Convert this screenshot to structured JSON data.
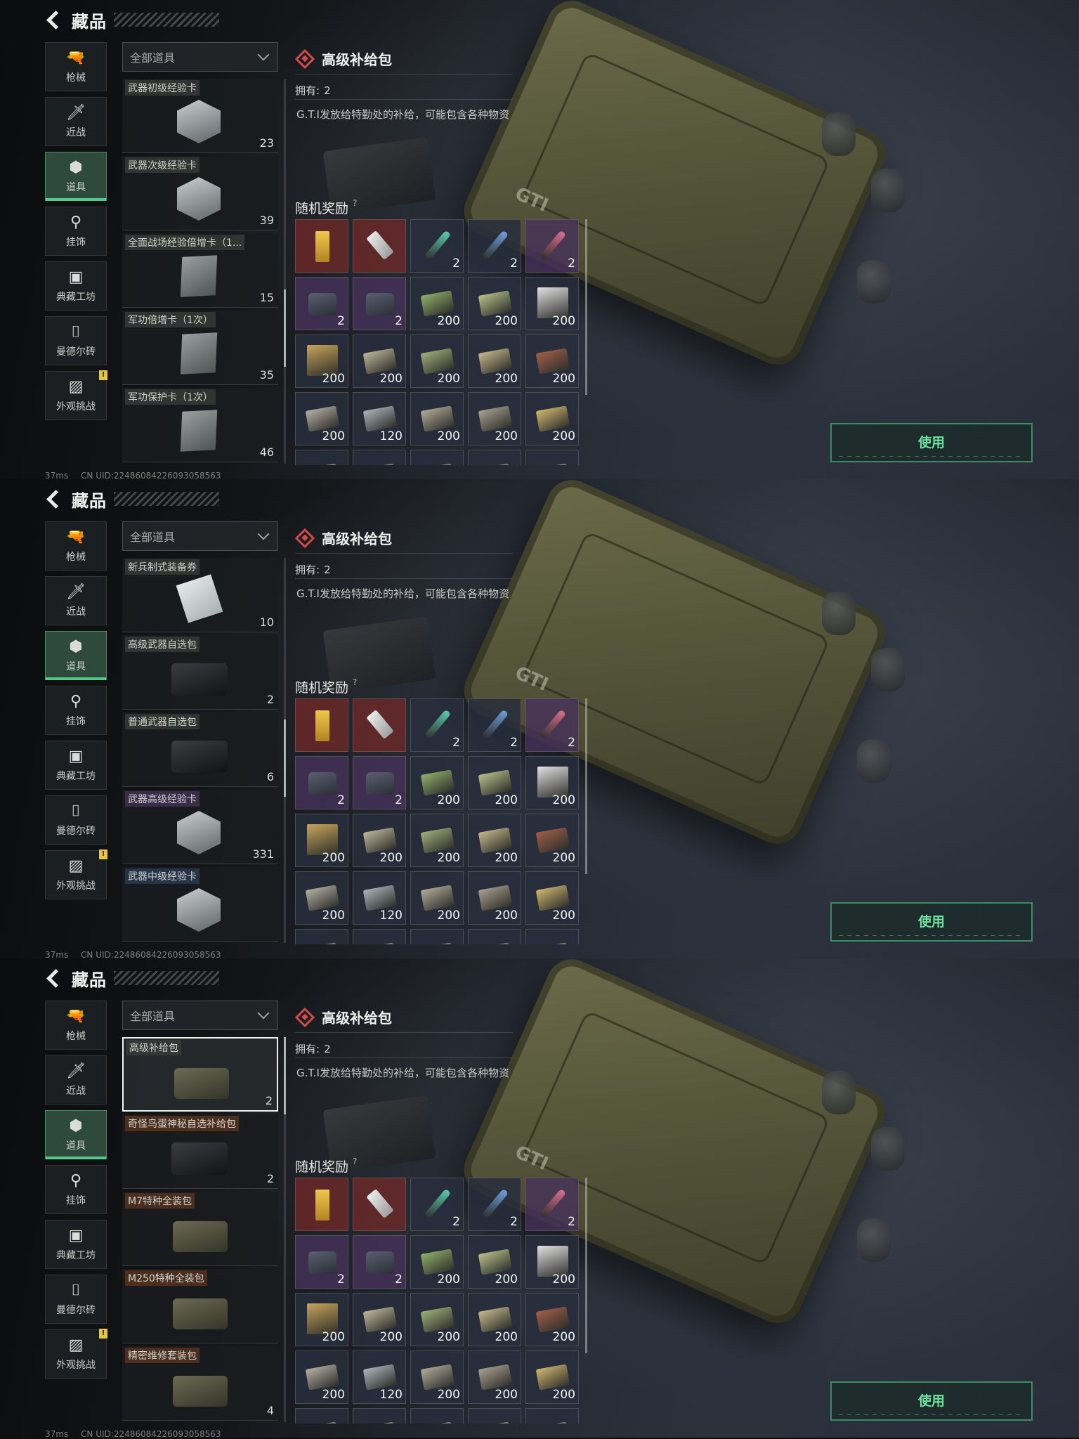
{
  "header": {
    "title": "藏品"
  },
  "nav": [
    {
      "label": "枪械",
      "icon": "rifle-icon",
      "glyph": "🔫"
    },
    {
      "label": "近战",
      "icon": "knife-icon",
      "glyph": "🗡"
    },
    {
      "label": "道具",
      "icon": "items-icon",
      "glyph": "⬢",
      "active": true
    },
    {
      "label": "挂饰",
      "icon": "charm-icon",
      "glyph": "⚲"
    },
    {
      "label": "典藏工坊",
      "icon": "workshop-icon",
      "glyph": "▣"
    },
    {
      "label": "曼德尔砖",
      "icon": "brick-icon",
      "glyph": "⌷"
    },
    {
      "label": "外观挑战",
      "icon": "picture-icon",
      "glyph": "▨",
      "badge": "!"
    }
  ],
  "filter": {
    "label": "全部道具"
  },
  "lists": [
    [
      {
        "name": "武器初级经验卡",
        "count": "23",
        "img": "hex",
        "tag": "plain"
      },
      {
        "name": "武器次级经验卡",
        "count": "39",
        "img": "hex",
        "tag": "plain"
      },
      {
        "name": "全面战场经验倍增卡（1...",
        "count": "15",
        "img": "card",
        "tag": "plain"
      },
      {
        "name": "军功倍增卡（1次）",
        "count": "35",
        "img": "card",
        "tag": "plain"
      },
      {
        "name": "军功保护卡（1次）",
        "count": "46",
        "img": "card",
        "tag": "plain"
      }
    ],
    [
      {
        "name": "新兵制式装备券",
        "count": "10",
        "img": "paper",
        "tag": "plain"
      },
      {
        "name": "高级武器自选包",
        "count": "2",
        "img": "black",
        "tag": "plain"
      },
      {
        "name": "普通武器自选包",
        "count": "6",
        "img": "black",
        "tag": "plain"
      },
      {
        "name": "武器高级经验卡",
        "count": "331",
        "img": "hex",
        "tag": "purple"
      },
      {
        "name": "武器中级经验卡",
        "count": "",
        "img": "hex",
        "tag": "blue"
      }
    ],
    [
      {
        "name": "高级补给包",
        "count": "2",
        "img": "case",
        "tag": "plain",
        "selected": true
      },
      {
        "name": "奇怪鸟蛋神秘自选补给包",
        "count": "2",
        "img": "black",
        "tag": "orange"
      },
      {
        "name": "M7特种全装包",
        "count": "",
        "img": "case",
        "tag": "orange"
      },
      {
        "name": "M250特种全装包",
        "count": "",
        "img": "case",
        "tag": "orange"
      },
      {
        "name": "精密维修套装包",
        "count": "4",
        "img": "case",
        "tag": "orange"
      }
    ]
  ],
  "detail": {
    "title": "高级补给包",
    "owned_label": "拥有:",
    "owned_value": "2",
    "description": "G.T.I发放给特勤处的补给，可能包含各种物资",
    "rewards_label": "随机奖励",
    "help": "?"
  },
  "rewards": [
    {
      "icon": "gold-bar-icon",
      "count": "",
      "bg": "red",
      "kind": "gold"
    },
    {
      "icon": "usb-drive-icon",
      "count": "",
      "bg": "red",
      "kind": "usb"
    },
    {
      "icon": "syringe-icon",
      "count": "2",
      "bg": "blue",
      "kind": "syringe",
      "color": "#5bd0b0"
    },
    {
      "icon": "syringe-icon",
      "count": "2",
      "bg": "blue",
      "kind": "syringe",
      "color": "#6fa0e0"
    },
    {
      "icon": "syringe-icon",
      "count": "2",
      "bg": "purple",
      "kind": "syringe",
      "color": "#e07090"
    },
    {
      "icon": "bag-icon",
      "count": "2",
      "bg": "purple",
      "kind": "bag"
    },
    {
      "icon": "bag-icon",
      "count": "2",
      "bg": "purple",
      "kind": "bag"
    },
    {
      "icon": "ammo-icon",
      "count": "200",
      "bg": "blue",
      "kind": "ammo",
      "color": "#8fb06a"
    },
    {
      "icon": "ammo-icon",
      "count": "200",
      "bg": "blue",
      "kind": "ammo",
      "color": "#b8c08a"
    },
    {
      "icon": "ammo-box-icon",
      "count": "200",
      "bg": "blue",
      "kind": "box",
      "color": "#e2e2e2"
    },
    {
      "icon": "ammo-box-icon",
      "count": "200",
      "bg": "blue",
      "kind": "box",
      "color": "#c8a45a"
    },
    {
      "icon": "ammo-icon",
      "count": "200",
      "bg": "blue",
      "kind": "ammo",
      "color": "#bfb79a"
    },
    {
      "icon": "ammo-icon",
      "count": "200",
      "bg": "blue",
      "kind": "ammo",
      "color": "#9fb07a"
    },
    {
      "icon": "ammo-icon",
      "count": "200",
      "bg": "blue",
      "kind": "ammo",
      "color": "#c4b88a"
    },
    {
      "icon": "ammo-icon",
      "count": "200",
      "bg": "blue",
      "kind": "ammo",
      "color": "#a0604a"
    },
    {
      "icon": "ammo-icon",
      "count": "200",
      "bg": "blue",
      "kind": "ammo",
      "color": "#b4b0a4"
    },
    {
      "icon": "ammo-icon",
      "count": "120",
      "bg": "blue",
      "kind": "ammo",
      "color": "#aab4b8"
    },
    {
      "icon": "ammo-icon",
      "count": "200",
      "bg": "blue",
      "kind": "ammo",
      "color": "#b0ac98"
    },
    {
      "icon": "ammo-icon",
      "count": "200",
      "bg": "blue",
      "kind": "ammo",
      "color": "#a8a090"
    },
    {
      "icon": "ammo-icon",
      "count": "200",
      "bg": "blue",
      "kind": "ammo",
      "color": "#d0b870"
    },
    {
      "icon": "ammo-icon",
      "count": "",
      "bg": "blue",
      "kind": "ammo",
      "color": "#a0a090"
    },
    {
      "icon": "ammo-icon",
      "count": "",
      "bg": "blue",
      "kind": "ammo",
      "color": "#a0a090"
    },
    {
      "icon": "ammo-icon",
      "count": "",
      "bg": "blue",
      "kind": "ammo",
      "color": "#a0a090"
    },
    {
      "icon": "ammo-icon",
      "count": "",
      "bg": "blue",
      "kind": "ammo",
      "color": "#a0a090"
    },
    {
      "icon": "ammo-icon",
      "count": "",
      "bg": "blue",
      "kind": "ammo",
      "color": "#a0a090"
    }
  ],
  "use_button": "使用",
  "scene": {
    "case_text": "GTI"
  },
  "footer": {
    "ping": "37ms",
    "uid": "CN UID:2248608422609305856​3"
  },
  "colors": {
    "accent": "#53c98b",
    "danger": "#d04a4a",
    "badge": "#e6c640"
  }
}
